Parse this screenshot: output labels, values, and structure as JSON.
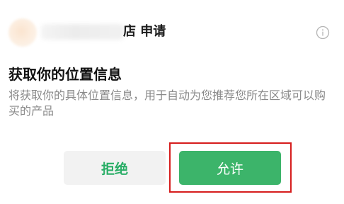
{
  "header": {
    "app_title_suffix": "店 申请",
    "info_icon": "info-circle-icon"
  },
  "permission": {
    "title": "获取你的位置信息",
    "description": "将获取你的具体位置信息，用于自动为您推荐您所在区域可以购买的产品"
  },
  "buttons": {
    "deny_label": "拒绝",
    "allow_label": "允许"
  },
  "colors": {
    "accent_green": "#3cb46a",
    "deny_text_green": "#2aae67",
    "deny_bg": "#f2f2f2",
    "highlight_red": "#d61d1d"
  }
}
